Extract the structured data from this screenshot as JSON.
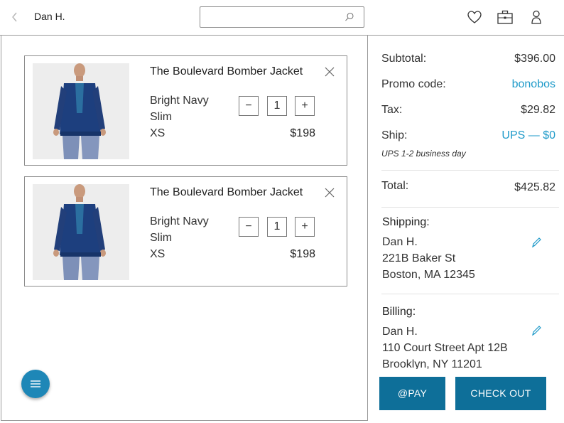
{
  "header": {
    "user_name": "Dan H.",
    "search_value": "",
    "search_placeholder": ""
  },
  "cart": {
    "items": [
      {
        "title": "The Boulevard Bomber Jacket",
        "color": "Bright Navy",
        "fit": "Slim",
        "size": "XS",
        "quantity": "1",
        "price": "$198",
        "decrement": "−",
        "increment": "+"
      },
      {
        "title": "The Boulevard Bomber Jacket",
        "color": "Bright Navy",
        "fit": "Slim",
        "size": "XS",
        "quantity": "1",
        "price": "$198",
        "decrement": "−",
        "increment": "+"
      }
    ]
  },
  "summary": {
    "subtotal_label": "Subtotal:",
    "subtotal_value": "$396.00",
    "promo_label": "Promo code:",
    "promo_value": "bonobos",
    "tax_label": "Tax:",
    "tax_value": "$29.82",
    "ship_label": "Ship:",
    "ship_value": "UPS — $0",
    "ship_note": "UPS 1-2 business day",
    "total_label": "Total:",
    "total_value": "$425.82"
  },
  "shipping": {
    "heading": "Shipping:",
    "name": "Dan H.",
    "street": "221B Baker St",
    "city": "Boston, MA 12345"
  },
  "billing": {
    "heading": "Billing:",
    "name": "Dan H.",
    "street": "110 Court Street Apt 12B",
    "city": "Brooklyn, NY 11201"
  },
  "actions": {
    "pay_label": "@PAY",
    "checkout_label": "CHECK OUT"
  },
  "colors": {
    "accent": "#1e9ac9",
    "button": "#0e6f99",
    "fab": "#1e87b7",
    "border": "#9a9a9a"
  },
  "icons": {
    "back": "chevron-left-icon",
    "search": "search-icon",
    "favorites": "heart-icon",
    "bag": "briefcase-icon",
    "account": "user-icon",
    "remove": "close-icon",
    "edit": "pencil-icon",
    "menu": "menu-icon"
  }
}
